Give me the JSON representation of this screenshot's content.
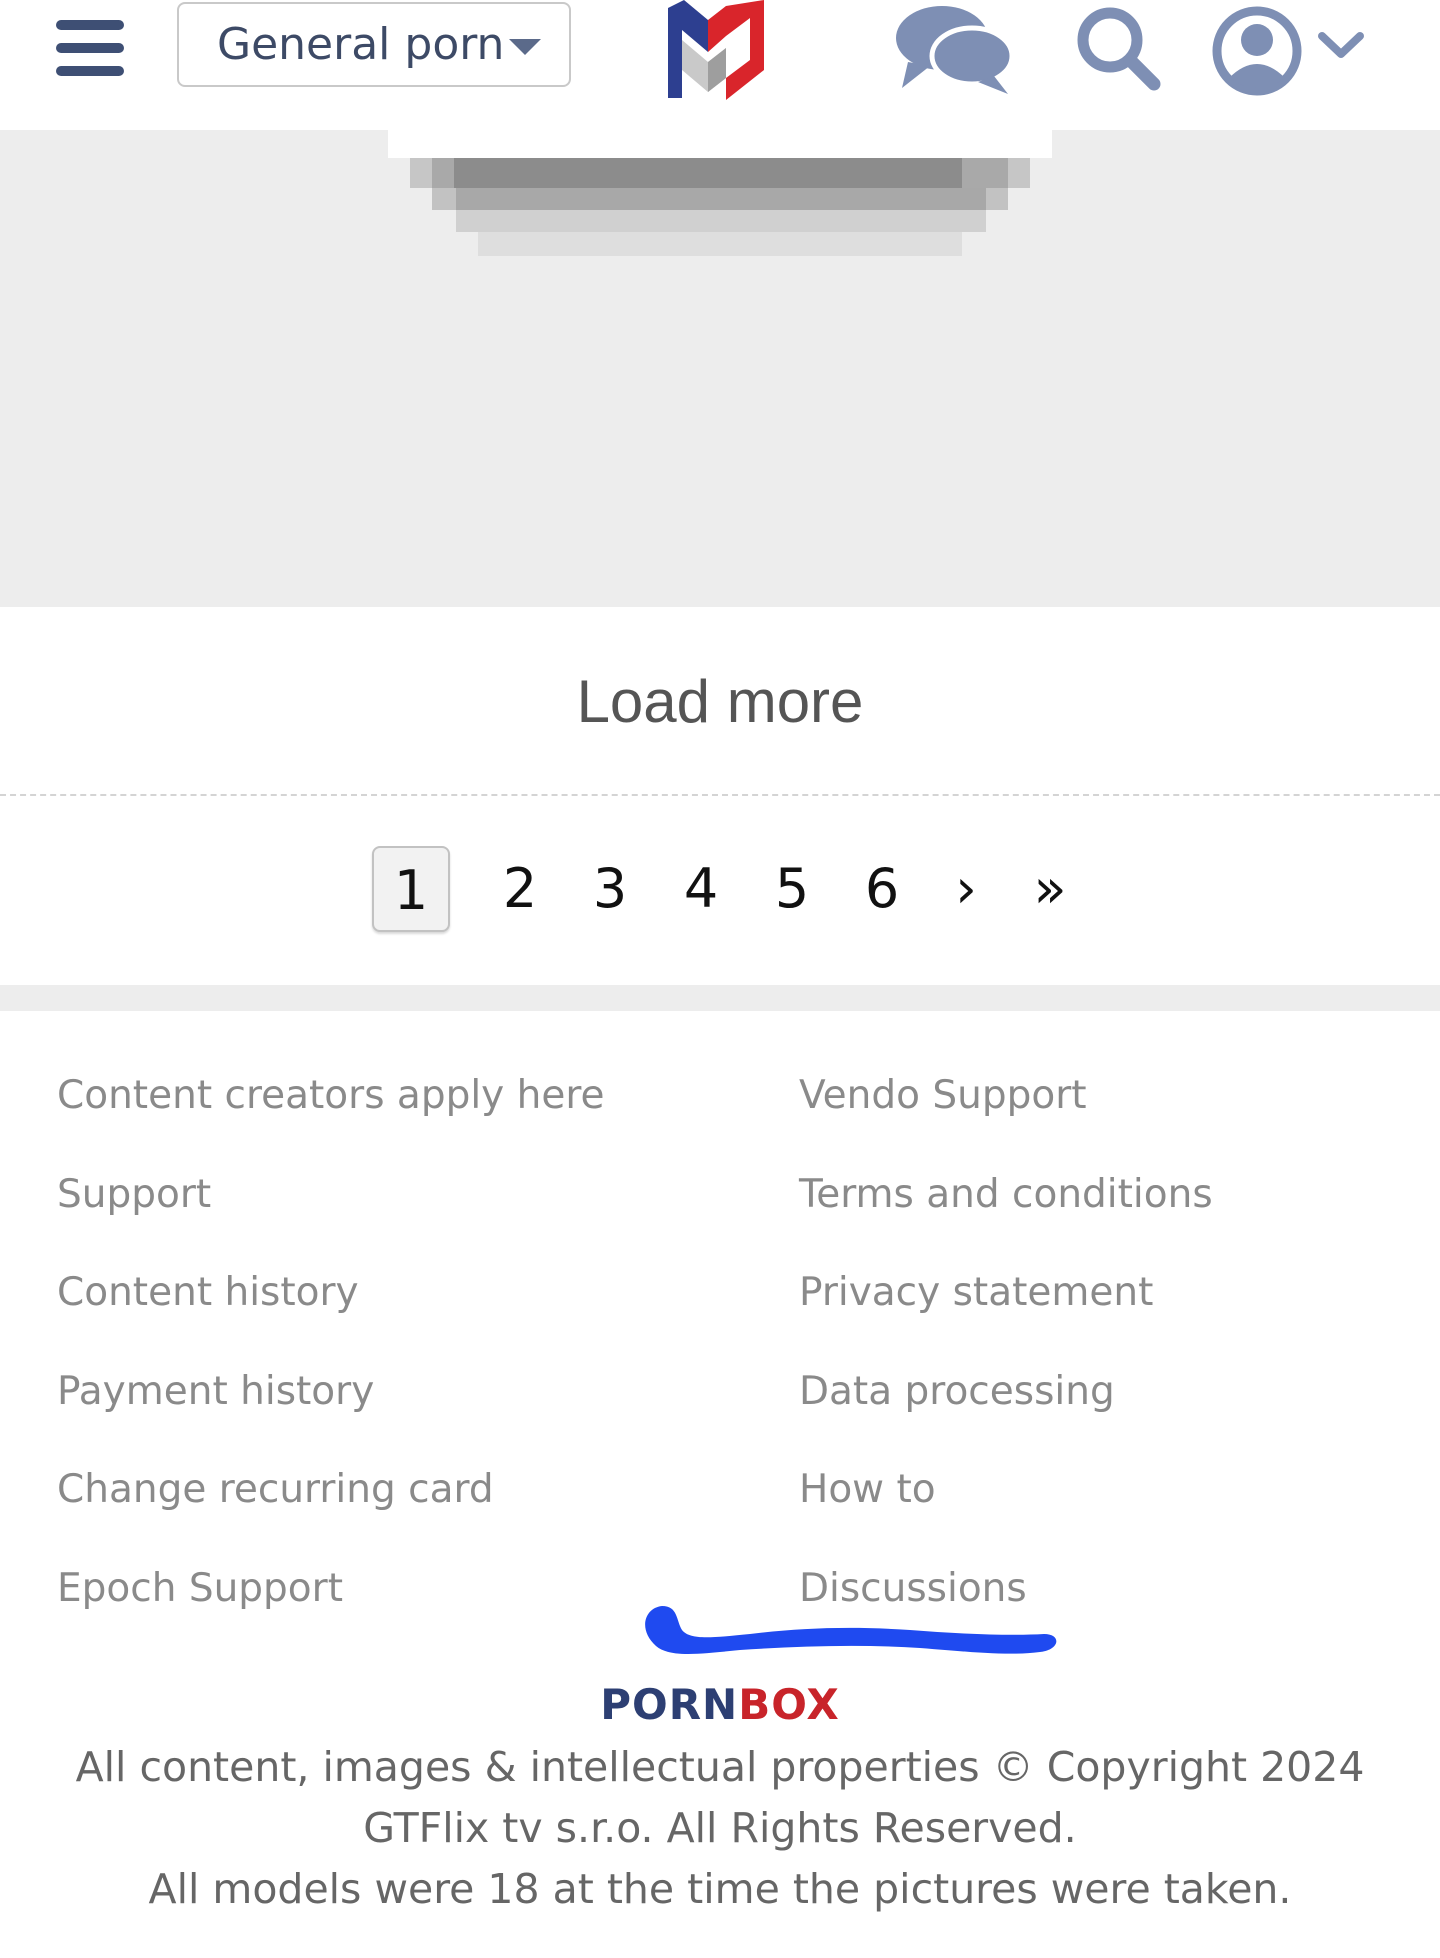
{
  "header": {
    "category_selected": "General porn",
    "icons": [
      "menu-icon",
      "logo",
      "chat-icon",
      "search-icon",
      "user-icon",
      "chevron-down-icon"
    ],
    "colors": {
      "icon_blue": "#3e4f74",
      "icon_light": "#7e8fb4",
      "logo_blue": "#2d3f90",
      "logo_red": "#d9252b"
    }
  },
  "main": {
    "load_more_label": "Load more"
  },
  "pagination": {
    "pages": [
      "1",
      "2",
      "3",
      "4",
      "5",
      "6"
    ],
    "current_page": "1",
    "next_label": "›",
    "last_label": "»"
  },
  "footer": {
    "links_left": [
      "Content creators apply here",
      "Support",
      "Content history",
      "Payment history",
      "Change recurring card",
      "Epoch Support"
    ],
    "links_right": [
      "Vendo Support",
      "Terms and conditions",
      "Privacy statement",
      "Data processing",
      "How to",
      "Discussions"
    ],
    "brand_part1": "PORN",
    "brand_part2": "BOX",
    "copyright_line1": "All content, images & intellectual properties © Copyright 2024",
    "copyright_line2": "GTFlix tv s.r.o. All Rights Reserved.",
    "copyright_line3": "All models were 18 at the time the pictures were taken."
  }
}
